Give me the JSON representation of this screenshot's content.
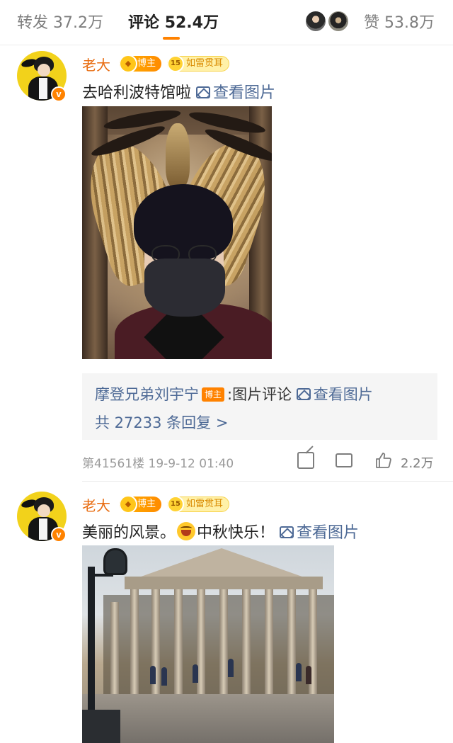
{
  "tabs": {
    "repost_label": "转发",
    "repost_count": "37.2万",
    "comment_label": "评论",
    "comment_count": "52.4万",
    "like_label": "赞",
    "like_count": "53.8万",
    "accent_color": "#ff8200"
  },
  "comments": [
    {
      "username": "老大",
      "badge_host": "博主",
      "badge_level_num": "15",
      "badge_level_text": "如雷贯耳",
      "verified_mark": "v",
      "text": "去哈利波特馆啦",
      "pic_link": "查看图片",
      "reply": {
        "name": "摩登兄弟刘宇宁",
        "badge": "博主",
        "text": ":图片评论",
        "pic_link": "查看图片",
        "count_text": "共 27233 条回复 >"
      },
      "floor": "第41561楼",
      "time": "19-9-12 01:40",
      "likes": "2.2万"
    },
    {
      "username": "老大",
      "badge_host": "博主",
      "badge_level_num": "15",
      "badge_level_text": "如雷贯耳",
      "verified_mark": "v",
      "text_before": "美丽的风景。",
      "emoji": "laugh-emoji",
      "text_after": "中秋快乐！",
      "pic_link": "查看图片"
    }
  ],
  "icons": {
    "share": "share-icon",
    "reply": "reply-icon",
    "like": "thumbs-up-icon",
    "image": "image-icon"
  }
}
